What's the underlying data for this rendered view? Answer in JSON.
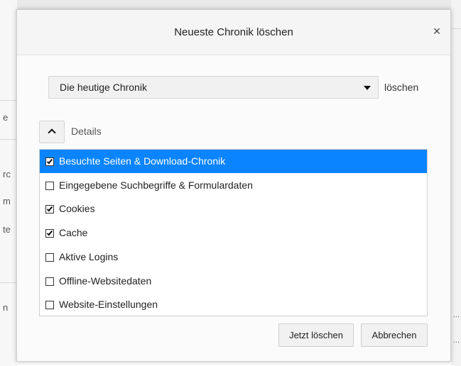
{
  "dialog": {
    "title": "Neueste Chronik löschen",
    "close_glyph": "×"
  },
  "range": {
    "selected": "Die heutige Chronik",
    "suffix": "löschen"
  },
  "details": {
    "label": "Details",
    "expanded": true
  },
  "items": [
    {
      "label": "Besuchte Seiten & Download-Chronik",
      "checked": true,
      "selected": true
    },
    {
      "label": "Eingegebene Suchbegriffe & Formulardaten",
      "checked": false,
      "selected": false
    },
    {
      "label": "Cookies",
      "checked": true,
      "selected": false
    },
    {
      "label": "Cache",
      "checked": true,
      "selected": false
    },
    {
      "label": "Aktive Logins",
      "checked": false,
      "selected": false
    },
    {
      "label": "Offline-Websitedaten",
      "checked": false,
      "selected": false
    },
    {
      "label": "Website-Einstellungen",
      "checked": false,
      "selected": false
    }
  ],
  "buttons": {
    "clear_now": "Jetzt löschen",
    "cancel": "Abbrechen"
  },
  "colors": {
    "selection": "#0a84ff"
  },
  "background": {
    "left_chars": [
      "e",
      "rc",
      "m",
      "te",
      "n"
    ],
    "right_chars": [
      "...",
      "..."
    ]
  }
}
